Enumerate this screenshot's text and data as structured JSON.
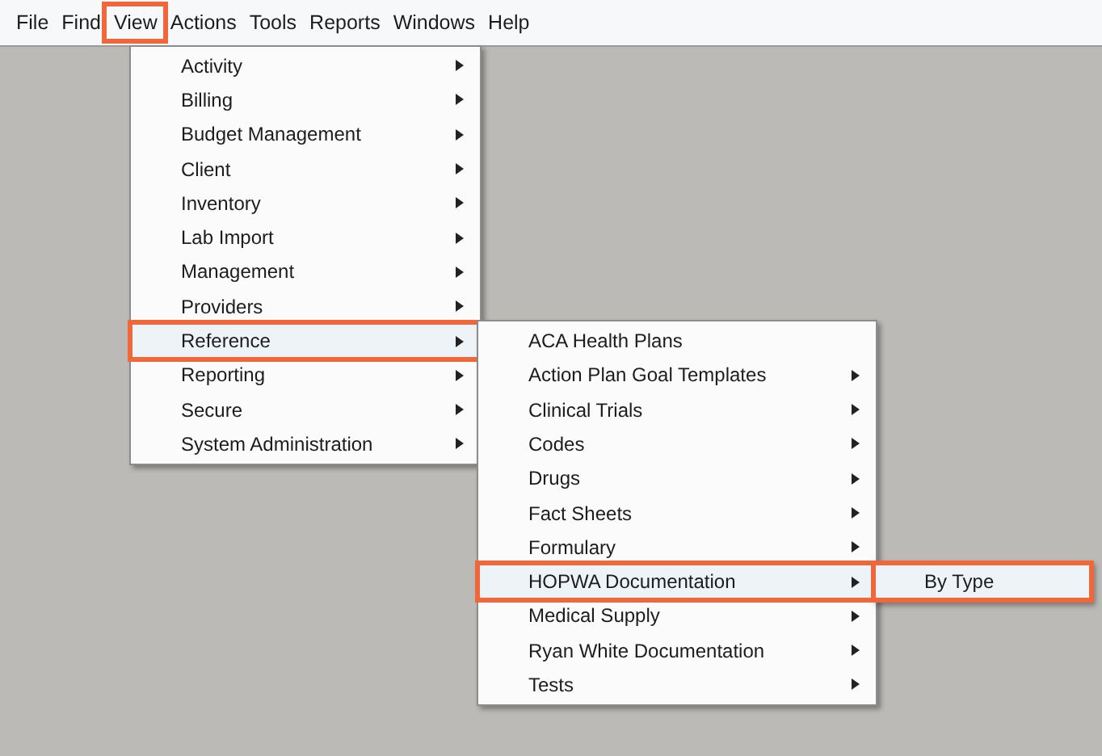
{
  "menu_bar": [
    {
      "label": "File",
      "selected": false
    },
    {
      "label": "Find",
      "selected": false
    },
    {
      "label": "View",
      "selected": true
    },
    {
      "label": "Actions",
      "selected": false
    },
    {
      "label": "Tools",
      "selected": false
    },
    {
      "label": "Reports",
      "selected": false
    },
    {
      "label": "Windows",
      "selected": false
    },
    {
      "label": "Help",
      "selected": false
    }
  ],
  "menu": {
    "items": [
      {
        "label": "Activity",
        "has_submenu": true,
        "selected": false
      },
      {
        "label": "Billing",
        "has_submenu": true,
        "selected": false
      },
      {
        "label": "Budget Management",
        "has_submenu": true,
        "selected": false
      },
      {
        "label": "Client",
        "has_submenu": true,
        "selected": false
      },
      {
        "label": "Inventory",
        "has_submenu": true,
        "selected": false
      },
      {
        "label": "Lab Import",
        "has_submenu": true,
        "selected": false
      },
      {
        "label": "Management",
        "has_submenu": true,
        "selected": false
      },
      {
        "label": "Providers",
        "has_submenu": true,
        "selected": false
      },
      {
        "label": "Reference",
        "has_submenu": true,
        "selected": true,
        "children": [
          {
            "label": "ACA Health Plans",
            "has_submenu": false,
            "selected": false
          },
          {
            "label": "Action Plan Goal Templates",
            "has_submenu": true,
            "selected": false
          },
          {
            "label": "Clinical Trials",
            "has_submenu": true,
            "selected": false
          },
          {
            "label": "Codes",
            "has_submenu": true,
            "selected": false
          },
          {
            "label": "Drugs",
            "has_submenu": true,
            "selected": false
          },
          {
            "label": "Fact Sheets",
            "has_submenu": true,
            "selected": false
          },
          {
            "label": "Formulary",
            "has_submenu": true,
            "selected": false
          },
          {
            "label": "HOPWA Documentation",
            "has_submenu": true,
            "selected": true,
            "children": [
              {
                "label": "By Type",
                "has_submenu": false,
                "selected": true
              }
            ]
          },
          {
            "label": "Medical Supply",
            "has_submenu": true,
            "selected": false
          },
          {
            "label": "Ryan White Documentation",
            "has_submenu": true,
            "selected": false
          },
          {
            "label": "Tests",
            "has_submenu": true,
            "selected": false
          }
        ]
      },
      {
        "label": "Reporting",
        "has_submenu": true,
        "selected": false
      },
      {
        "label": "Secure",
        "has_submenu": true,
        "selected": false
      },
      {
        "label": "System Administration",
        "has_submenu": true,
        "selected": false
      }
    ]
  }
}
